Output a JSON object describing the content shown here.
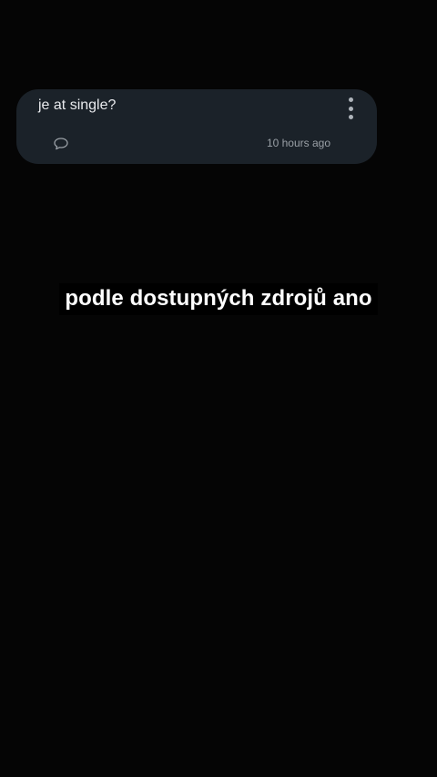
{
  "question_card": {
    "text": "je at single?",
    "timestamp": "10 hours ago",
    "comment_icon": "speech-bubble-icon",
    "more_icon": "vertical-ellipsis-icon"
  },
  "caption": {
    "text": "podle dostupných zdrojů ano"
  },
  "colors": {
    "background": "#050505",
    "card": "#1b2229",
    "question_text": "#e8eaed",
    "secondary_text": "#9aa0a6",
    "caption_text": "#ffffff"
  }
}
